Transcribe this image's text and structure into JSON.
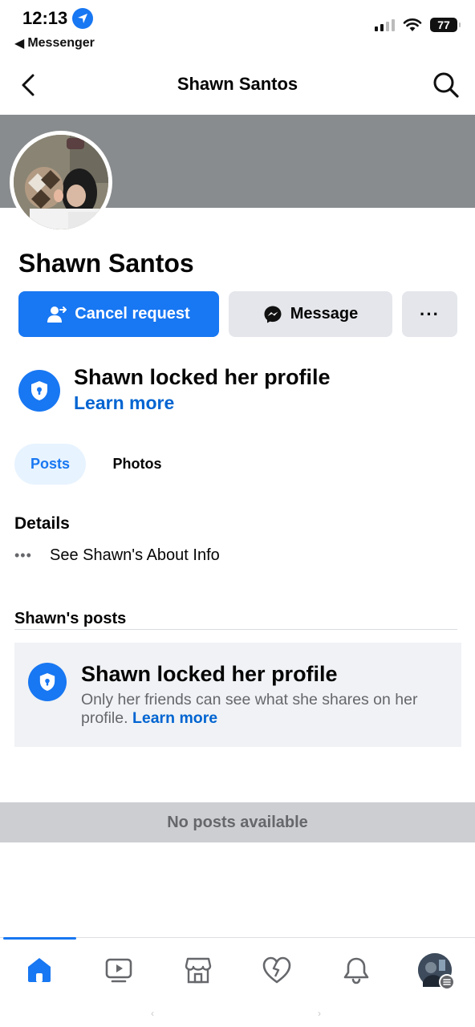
{
  "status": {
    "time": "12:13",
    "back_app": "Messenger",
    "battery": "77"
  },
  "header": {
    "title": "Shawn Santos"
  },
  "profile": {
    "name": "Shawn Santos",
    "actions": {
      "cancel_request": "Cancel request",
      "message": "Message",
      "more": "···"
    },
    "locked_banner": {
      "title": "Shawn locked her profile",
      "link": "Learn more"
    }
  },
  "tabs": [
    {
      "label": "Posts",
      "active": true
    },
    {
      "label": "Photos",
      "active": false
    }
  ],
  "details": {
    "title": "Details",
    "about_dots": "•••",
    "about_label": "See Shawn's About Info"
  },
  "posts_section": {
    "heading": "Shawn's posts",
    "card_title": "Shawn locked her profile",
    "card_text": "Only her friends can see what she shares on her profile.",
    "card_link": "Learn more",
    "empty_label": "No posts available"
  },
  "bottom_nav": {
    "icons": [
      "home-icon",
      "video-icon",
      "marketplace-icon",
      "dating-icon",
      "notifications-icon",
      "profile-avatar"
    ],
    "active": "home-icon"
  },
  "colors": {
    "accent": "#1877f2",
    "link": "#0064d1",
    "cover": "#898c8e",
    "button_gray": "#e4e6eb"
  }
}
